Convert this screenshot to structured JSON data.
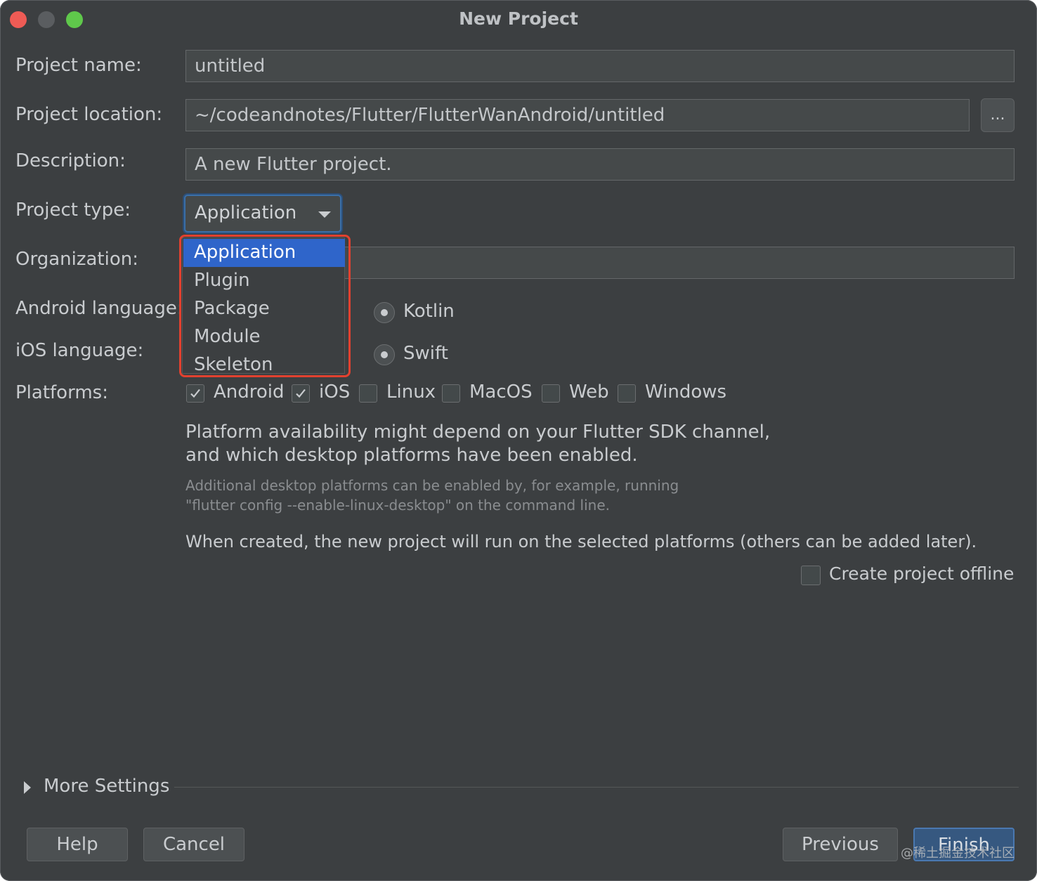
{
  "window": {
    "title": "New Project"
  },
  "form": {
    "project_name": {
      "label": "Project name:",
      "value": "untitled"
    },
    "project_location": {
      "label": "Project location:",
      "value": "~/codeandnotes/Flutter/FlutterWanAndroid/untitled",
      "browse_label": "..."
    },
    "description": {
      "label": "Description:",
      "value": "A new Flutter project."
    },
    "project_type": {
      "label": "Project type:",
      "selected": "Application",
      "options": [
        "Application",
        "Plugin",
        "Package",
        "Module",
        "Skeleton"
      ]
    },
    "organization": {
      "label": "Organization:",
      "value": ""
    },
    "android_language": {
      "label": "Android language:",
      "option": "Kotlin"
    },
    "ios_language": {
      "label": "iOS language:",
      "option": "Swift"
    },
    "platforms": {
      "label": "Platforms:",
      "items": [
        {
          "label": "Android",
          "checked": true
        },
        {
          "label": "iOS",
          "checked": true
        },
        {
          "label": "Linux",
          "checked": false
        },
        {
          "label": "MacOS",
          "checked": false
        },
        {
          "label": "Web",
          "checked": false
        },
        {
          "label": "Windows",
          "checked": false
        }
      ]
    },
    "info_line1": "Platform availability might depend on your Flutter SDK channel,",
    "info_line2": "and which desktop platforms have been enabled.",
    "hint_line1": "Additional desktop platforms can be enabled by, for example, running",
    "hint_line2": "\"flutter config --enable-linux-desktop\" on the command line.",
    "created_note": "When created, the new project will run on the selected platforms (others can be added later).",
    "offline": {
      "label": "Create project offline",
      "checked": false
    }
  },
  "more_settings": {
    "label": "More Settings"
  },
  "buttons": {
    "help": "Help",
    "cancel": "Cancel",
    "previous": "Previous",
    "finish": "Finish"
  },
  "watermark": "@稀土掘金技术社区",
  "colors": {
    "accent": "#2f65ca",
    "highlight": "#e2412f",
    "background": "#3c3f41"
  }
}
